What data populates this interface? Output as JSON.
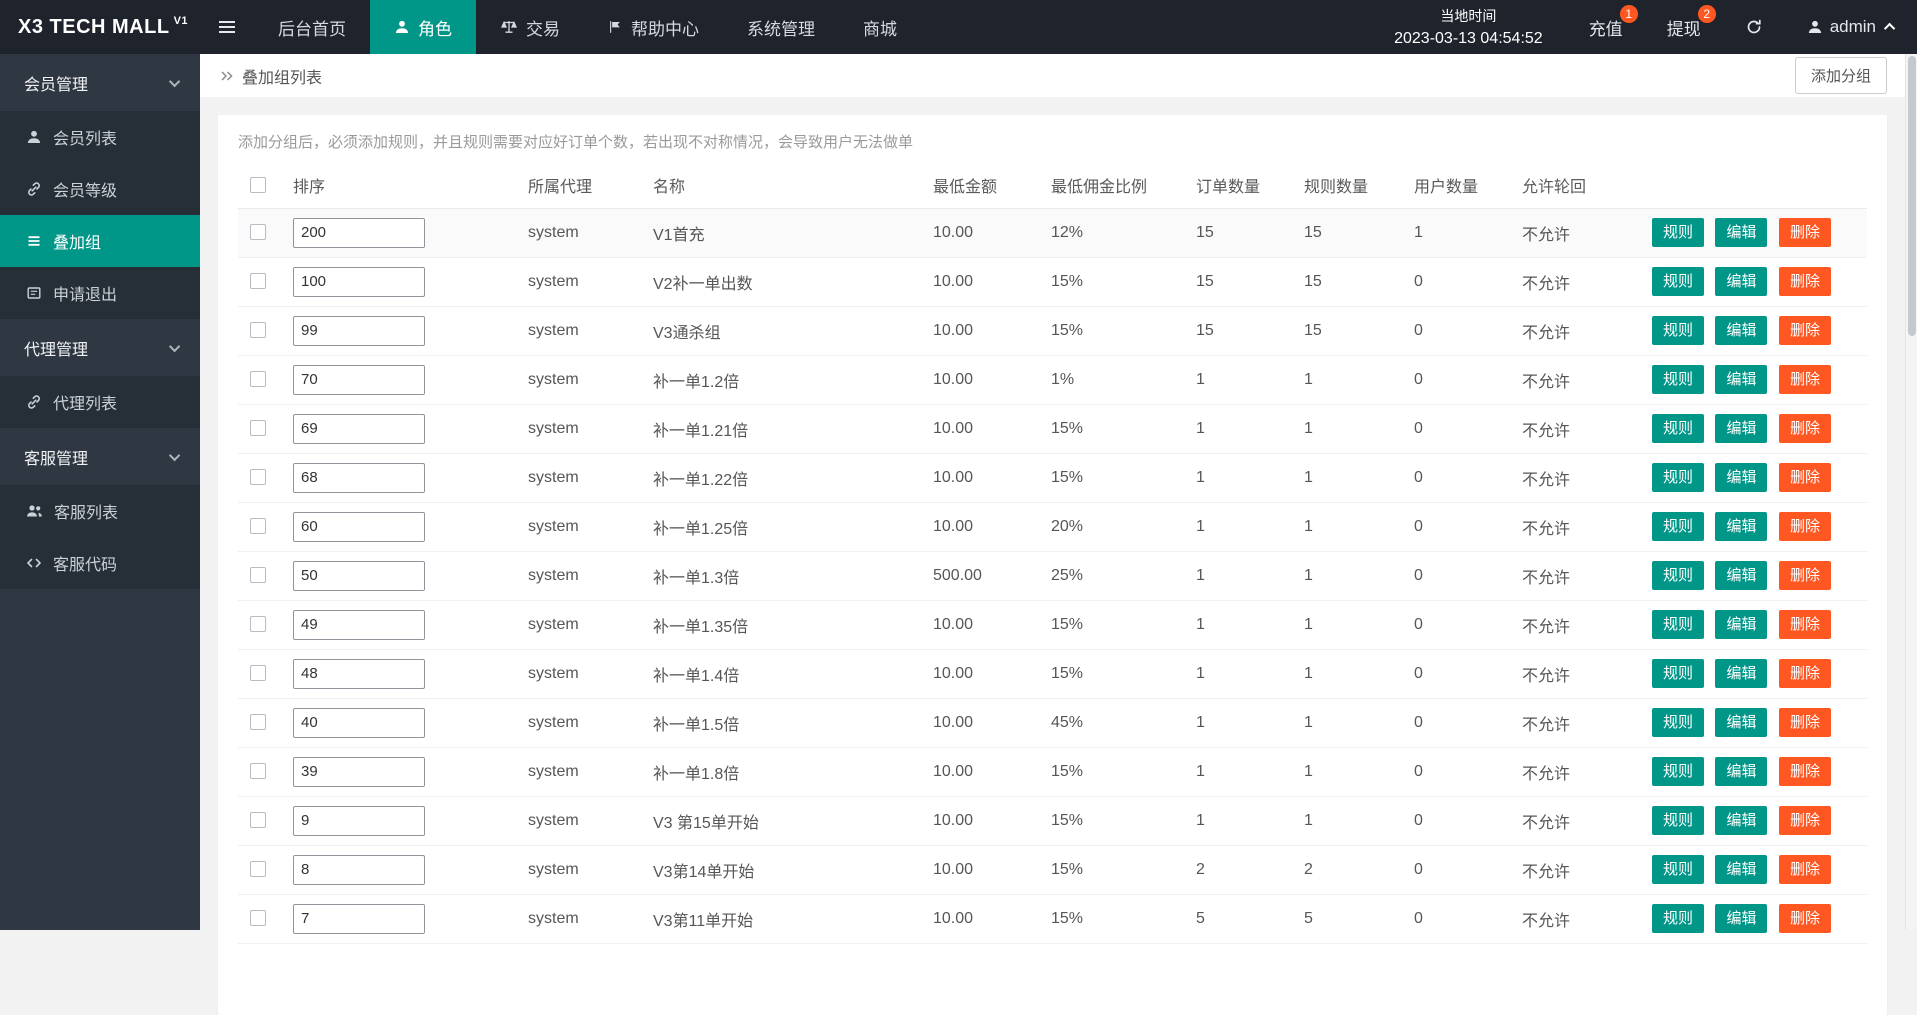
{
  "topbar": {
    "logo": "X3 TECH MALL",
    "logo_version": "V1",
    "nav": [
      {
        "label": "后台首页"
      },
      {
        "label": "角色"
      },
      {
        "label": "交易"
      },
      {
        "label": "帮助中心"
      },
      {
        "label": "系统管理"
      },
      {
        "label": "商城"
      }
    ],
    "time_label": "当地时间",
    "time_value": "2023-03-13 04:54:52",
    "recharge_label": "充值",
    "recharge_badge": "1",
    "withdraw_label": "提现",
    "withdraw_badge": "2",
    "username": "admin"
  },
  "sidebar": {
    "items": [
      {
        "type": "group",
        "label": "会员管理",
        "icon": "chevron-down-icon"
      },
      {
        "type": "item",
        "label": "会员列表",
        "icon": "user-icon"
      },
      {
        "type": "item",
        "label": "会员等级",
        "icon": "link-icon"
      },
      {
        "type": "item",
        "label": "叠加组",
        "icon": "list-icon",
        "active": true
      },
      {
        "type": "item",
        "label": "申请退出",
        "icon": "card-icon"
      },
      {
        "type": "group",
        "label": "代理管理",
        "icon": "chevron-down-icon"
      },
      {
        "type": "item",
        "label": "代理列表",
        "icon": "link-icon"
      },
      {
        "type": "group",
        "label": "客服管理",
        "icon": "chevron-down-icon"
      },
      {
        "type": "item",
        "label": "客服列表",
        "icon": "users-icon"
      },
      {
        "type": "item",
        "label": "客服代码",
        "icon": "code-icon"
      }
    ]
  },
  "breadcrumb": {
    "title": "叠加组列表"
  },
  "toolbar": {
    "add_group_label": "添加分组"
  },
  "hint": "添加分组后，必须添加规则，并且规则需要对应好订单个数，若出现不对称情况，会导致用户无法做单",
  "table": {
    "headers": [
      "排序",
      "所属代理",
      "名称",
      "最低金额",
      "最低佣金比例",
      "订单数量",
      "规则数量",
      "用户数量",
      "允许轮回"
    ],
    "actions": {
      "rule": "规则",
      "edit": "编辑",
      "delete": "删除"
    },
    "rows": [
      {
        "sort": "200",
        "agent": "system",
        "name": "V1首充",
        "min_amount": "10.00",
        "commission": "12%",
        "orders": "15",
        "rules": "15",
        "users": "1",
        "loop": "不允许"
      },
      {
        "sort": "100",
        "agent": "system",
        "name": "V2补一单出数",
        "min_amount": "10.00",
        "commission": "15%",
        "orders": "15",
        "rules": "15",
        "users": "0",
        "loop": "不允许"
      },
      {
        "sort": "99",
        "agent": "system",
        "name": "V3通杀组",
        "min_amount": "10.00",
        "commission": "15%",
        "orders": "15",
        "rules": "15",
        "users": "0",
        "loop": "不允许"
      },
      {
        "sort": "70",
        "agent": "system",
        "name": "补一单1.2倍",
        "min_amount": "10.00",
        "commission": "1%",
        "orders": "1",
        "rules": "1",
        "users": "0",
        "loop": "不允许"
      },
      {
        "sort": "69",
        "agent": "system",
        "name": "补一单1.21倍",
        "min_amount": "10.00",
        "commission": "15%",
        "orders": "1",
        "rules": "1",
        "users": "0",
        "loop": "不允许"
      },
      {
        "sort": "68",
        "agent": "system",
        "name": "补一单1.22倍",
        "min_amount": "10.00",
        "commission": "15%",
        "orders": "1",
        "rules": "1",
        "users": "0",
        "loop": "不允许"
      },
      {
        "sort": "60",
        "agent": "system",
        "name": "补一单1.25倍",
        "min_amount": "10.00",
        "commission": "20%",
        "orders": "1",
        "rules": "1",
        "users": "0",
        "loop": "不允许"
      },
      {
        "sort": "50",
        "agent": "system",
        "name": "补一单1.3倍",
        "min_amount": "500.00",
        "commission": "25%",
        "orders": "1",
        "rules": "1",
        "users": "0",
        "loop": "不允许"
      },
      {
        "sort": "49",
        "agent": "system",
        "name": "补一单1.35倍",
        "min_amount": "10.00",
        "commission": "15%",
        "orders": "1",
        "rules": "1",
        "users": "0",
        "loop": "不允许"
      },
      {
        "sort": "48",
        "agent": "system",
        "name": "补一单1.4倍",
        "min_amount": "10.00",
        "commission": "15%",
        "orders": "1",
        "rules": "1",
        "users": "0",
        "loop": "不允许"
      },
      {
        "sort": "40",
        "agent": "system",
        "name": "补一单1.5倍",
        "min_amount": "10.00",
        "commission": "45%",
        "orders": "1",
        "rules": "1",
        "users": "0",
        "loop": "不允许"
      },
      {
        "sort": "39",
        "agent": "system",
        "name": "补一单1.8倍",
        "min_amount": "10.00",
        "commission": "15%",
        "orders": "1",
        "rules": "1",
        "users": "0",
        "loop": "不允许"
      },
      {
        "sort": "9",
        "agent": "system",
        "name": "V3 第15单开始",
        "min_amount": "10.00",
        "commission": "15%",
        "orders": "1",
        "rules": "1",
        "users": "0",
        "loop": "不允许"
      },
      {
        "sort": "8",
        "agent": "system",
        "name": "V3第14单开始",
        "min_amount": "10.00",
        "commission": "15%",
        "orders": "2",
        "rules": "2",
        "users": "0",
        "loop": "不允许"
      },
      {
        "sort": "7",
        "agent": "system",
        "name": "V3第11单开始",
        "min_amount": "10.00",
        "commission": "15%",
        "orders": "5",
        "rules": "5",
        "users": "0",
        "loop": "不允许"
      }
    ]
  },
  "colors": {
    "accent": "#009688",
    "danger": "#ff5722",
    "topbar_bg": "#1f232c",
    "sidebar_bg": "#2f3743"
  }
}
